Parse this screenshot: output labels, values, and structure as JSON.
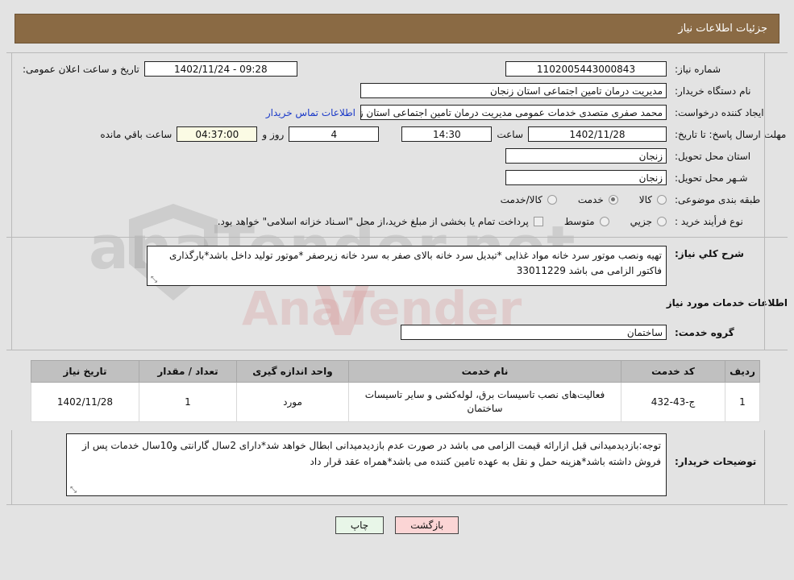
{
  "header": {
    "title": "جزئیات اطلاعات نیاز"
  },
  "form": {
    "need_number_label": "شماره نیاز:",
    "need_number_value": "1102005443000843",
    "announce_label": "تاریخ و ساعت اعلان عمومی:",
    "announce_value": "09:28 - 1402/11/24",
    "buyer_org_label": "نام دستگاه خریدار:",
    "buyer_org_value": "مدیریت درمان تامین اجتماعی استان زنجان",
    "creator_label": "ایجاد کننده درخواست:",
    "creator_value": "محمد صفری متصدی خدمات عمومی مدیریت درمان تامین اجتماعی استان زنجان",
    "contact_link": "اطلاعات تماس خریدار",
    "deadline_label": "مهلت ارسال پاسخ: تا تاریخ:",
    "deadline_date": "1402/11/28",
    "hour_label": "ساعت",
    "deadline_time": "14:30",
    "remaining_days": "4",
    "days_and_label": "روز و",
    "remaining_time": "04:37:00",
    "remaining_suffix": "ساعت باقي مانده",
    "province_label": "استان محل تحویل:",
    "province_value": "زنجان",
    "city_label": "شـهر محل تحویل:",
    "city_value": "زنجان",
    "category_label": "طبقه بندی موضوعی:",
    "category_options": [
      {
        "label": "کالا",
        "selected": false
      },
      {
        "label": "خدمت",
        "selected": true
      },
      {
        "label": "کالا/خدمت",
        "selected": false
      }
    ],
    "process_label": "نوع فرأیند خرید :",
    "process_options": [
      {
        "label": "جزیي",
        "selected": false
      },
      {
        "label": "متوسط",
        "selected": false
      }
    ],
    "treasury_checkbox_label": "پرداخت تمام یا بخشی از مبلغ خرید،از محل \"اسـناد خزانه اسلامی\" خواهد بود.",
    "treasury_checked": false
  },
  "description": {
    "label": "شرح کلي نیاز:",
    "text": "تهیه ونصب موتور سرد خانه مواد غذایی *تبدیل سرد خانه بالای صفر به سرد خانه زیرصفر *موتور تولید داخل باشد*بارگذاری فاکتور الزامی می باشد 33011229"
  },
  "services_section": {
    "heading": "اطلاعات خدمات مورد نیاز",
    "group_label": "گروه خدمت:",
    "group_value": "ساختمان"
  },
  "table": {
    "columns": [
      "ردیف",
      "کد خدمت",
      "نام خدمت",
      "واحد اندازه گیری",
      "تعداد / مقدار",
      "تاریخ نیاز"
    ],
    "rows": [
      {
        "radif": "1",
        "code": "ج-43-432",
        "name": "فعالیت‌های نصب تاسیسات برق، لوله‌کشی و سایر تاسیسات ساختمان",
        "unit": "مورد",
        "qty": "1",
        "date": "1402/11/28"
      }
    ]
  },
  "notes": {
    "label": "توضیحات خریدار:",
    "text": "توجه:بازدیدمیدانی قبل ازارائه قیمت الزامی می باشد در صورت عدم بازدیدمیدانی ابطال خواهد شد*دارای 2سال گارانتی و10سال خدمات پس از فروش داشته باشد*هزینه حمل و نقل به عهده تامین کننده می باشد*همراه عقد قرار داد"
  },
  "buttons": {
    "print": "چاپ",
    "back": "بازگشت"
  },
  "watermark": {
    "text": "anaTender.net",
    "mid": "AnaTender"
  },
  "colors": {
    "header_bg": "#8a6a44",
    "link": "#1a39c8",
    "table_head": "#c0c0c0",
    "print_btn": "#e8f6e8",
    "back_btn": "#fbd5d5",
    "cream_field": "#fbfbe4"
  }
}
